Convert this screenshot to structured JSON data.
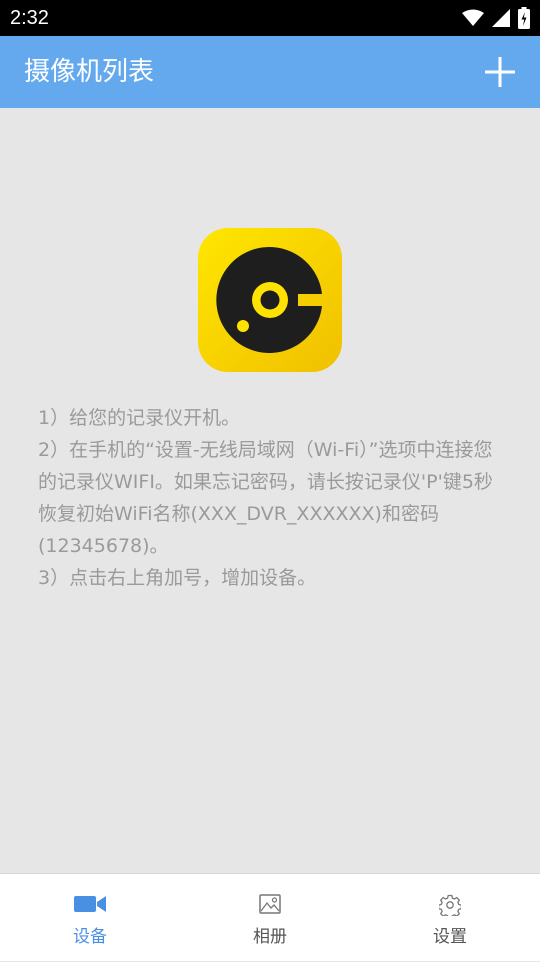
{
  "status_bar": {
    "time": "2:32"
  },
  "header": {
    "title": "摄像机列表"
  },
  "main": {
    "instructions": [
      "1）给您的记录仪开机。",
      "2）在手机的“设置-无线局域网（Wi-Fi）”选项中连接您的记录仪WIFI。如果忘记密码，请长按记录仪'P'键5秒恢复初始WiFi名称(XXX_DVR_XXXXXX)和密码(12345678)。",
      "3）点击右上角加号，增加设备。"
    ]
  },
  "bottom_nav": {
    "items": [
      {
        "label": "设备",
        "icon": "video-camera-icon",
        "active": true
      },
      {
        "label": "相册",
        "icon": "image-icon",
        "active": false
      },
      {
        "label": "设置",
        "icon": "gear-icon",
        "active": false
      }
    ]
  },
  "colors": {
    "app_bar": "#64a9ee",
    "background": "#e6e6e6",
    "active": "#4a90e2",
    "inactive": "#555555",
    "logo_yellow": "#f5cf00"
  }
}
